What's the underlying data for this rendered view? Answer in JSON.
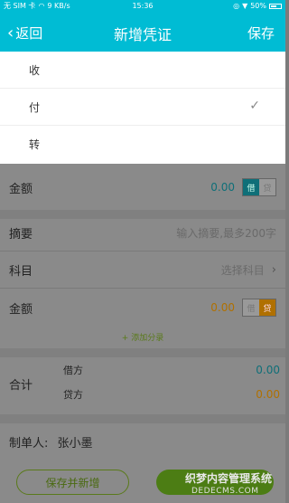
{
  "status_bar": {
    "carrier": "无 SIM 卡",
    "speed": "9 KB/s",
    "time": "15:36",
    "battery": "50%"
  },
  "nav": {
    "back_label": "返回",
    "title": "新增凭证",
    "save_label": "保存"
  },
  "type_menu": {
    "items": [
      {
        "label": "收",
        "selected": false
      },
      {
        "label": "付",
        "selected": true
      },
      {
        "label": "转",
        "selected": false
      }
    ]
  },
  "amount_row_1": {
    "label": "金额",
    "value": "0.00",
    "debit": "借",
    "credit": "贷",
    "active": "借"
  },
  "summary_row": {
    "label": "摘要",
    "placeholder": "输入摘要,最多200字"
  },
  "account_row": {
    "label": "科目",
    "placeholder": "选择科目"
  },
  "amount_row_2": {
    "label": "金额",
    "value": "0.00",
    "debit": "借",
    "credit": "贷",
    "active": "贷"
  },
  "add_entry_label": "添加分录",
  "totals": {
    "label": "合计",
    "debit_label": "借方",
    "debit_value": "0.00",
    "credit_label": "贷方",
    "credit_value": "0.00"
  },
  "maker": {
    "label": "制单人:",
    "name": "张小墨"
  },
  "buttons": {
    "save_and_new": "保存并新增"
  },
  "watermark": {
    "line1": "织梦内容管理系统",
    "line2": "DEDECMS.COM"
  },
  "colors": {
    "header": "#00bcd4",
    "debit_teal": "#0f6f78",
    "credit_orange": "#b07000",
    "green": "#4c7d14"
  }
}
